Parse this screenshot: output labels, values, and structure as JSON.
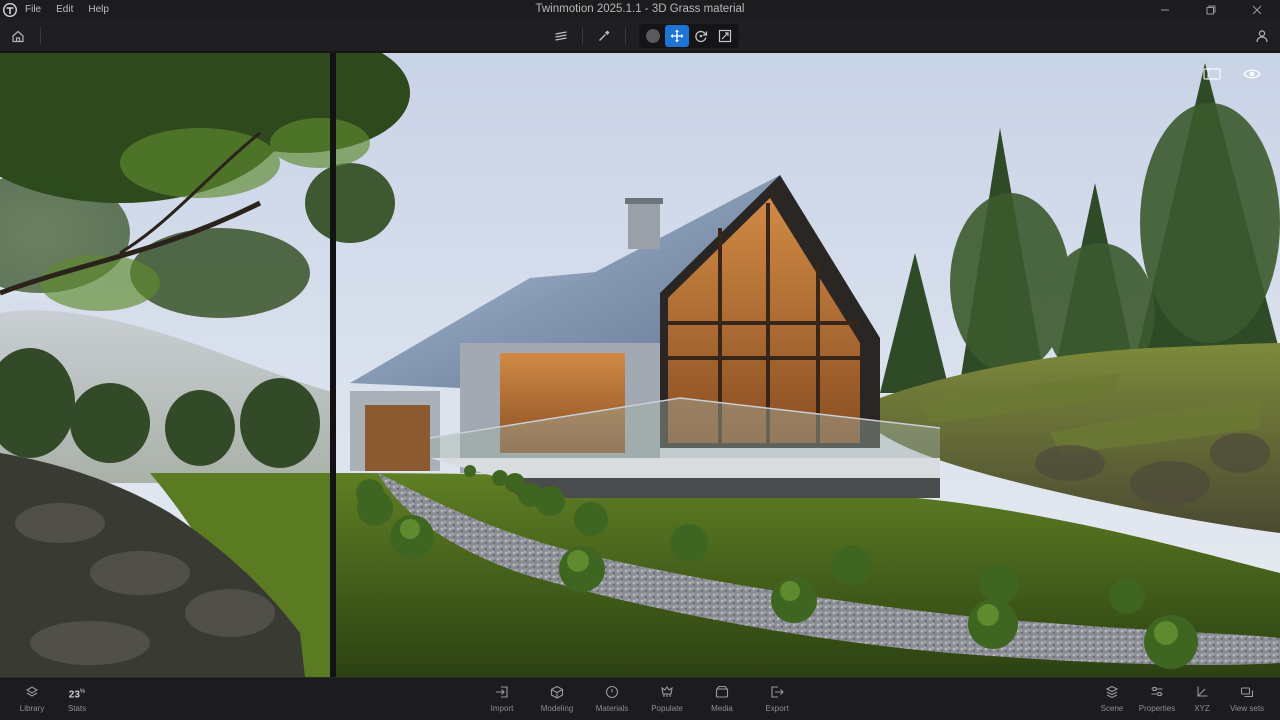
{
  "window": {
    "title": "Twinmotion 2025.1.1 - 3D Grass material",
    "menu": [
      "File",
      "Edit",
      "Help"
    ],
    "logo_icon": "twinmotion-logo-icon",
    "controls": [
      "minimize-icon",
      "restore-icon",
      "close-icon"
    ]
  },
  "toolbar": {
    "left": [
      "home-icon"
    ],
    "center": [
      {
        "name": "layers-icon",
        "active": false
      },
      {
        "name": "eyedropper-icon",
        "active": false
      },
      {
        "name": "selection-circle-icon",
        "active": false
      },
      {
        "name": "move-icon",
        "active": true
      },
      {
        "name": "rotate-icon",
        "active": false
      },
      {
        "name": "scale-icon",
        "active": false
      }
    ],
    "right": [
      "user-icon"
    ],
    "accent_color": "#1e74d2"
  },
  "viewport": {
    "overlay_icons": [
      "viewport-frame-icon",
      "visibility-eye-icon"
    ]
  },
  "dock": {
    "left": [
      {
        "label": "Library",
        "icon": "library-icon"
      },
      {
        "label": "Stats",
        "value": "23",
        "unit": "%"
      }
    ],
    "center": [
      {
        "label": "Import",
        "icon": "import-icon"
      },
      {
        "label": "Modeling",
        "icon": "modeling-cube-icon"
      },
      {
        "label": "Materials",
        "icon": "materials-icon"
      },
      {
        "label": "Populate",
        "icon": "populate-icon"
      },
      {
        "label": "Media",
        "icon": "media-icon"
      },
      {
        "label": "Export",
        "icon": "export-icon"
      }
    ],
    "right": [
      {
        "label": "Scene",
        "icon": "scene-layers-icon"
      },
      {
        "label": "Properties",
        "icon": "properties-sliders-icon"
      },
      {
        "label": "XYZ",
        "icon": "xyz-axis-icon"
      },
      {
        "label": "View sets",
        "icon": "view-sets-icon"
      }
    ]
  }
}
